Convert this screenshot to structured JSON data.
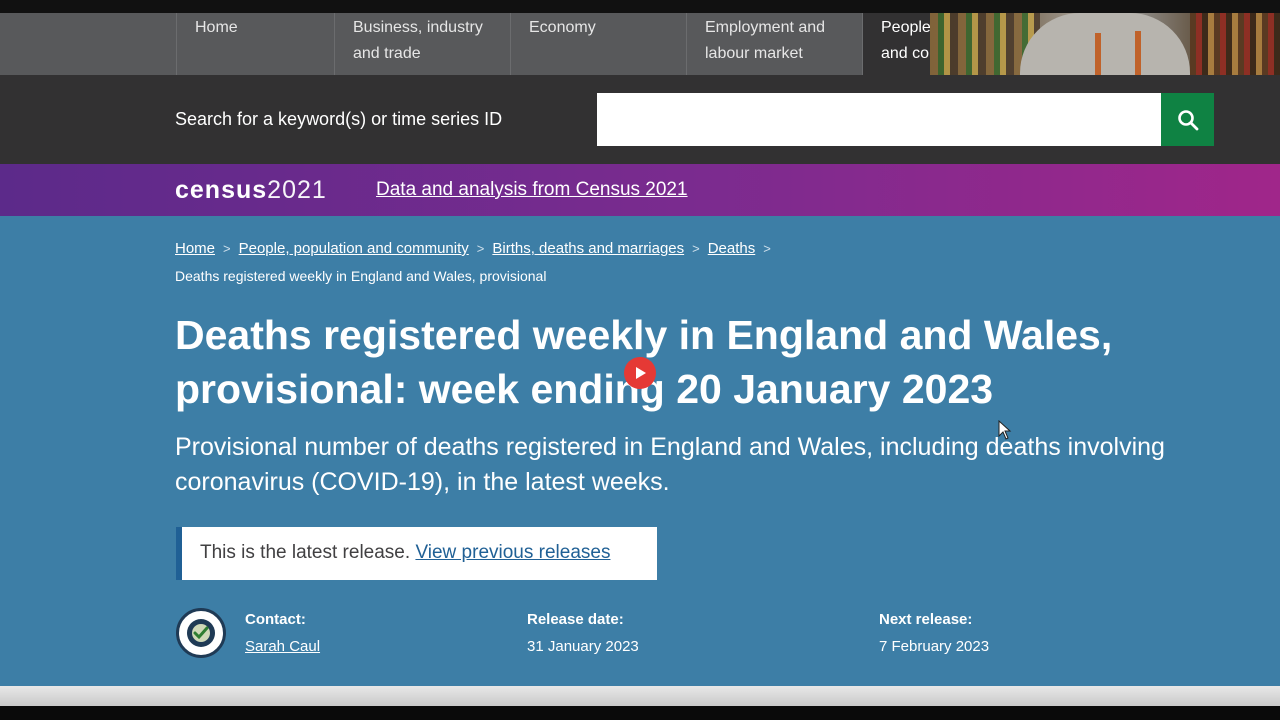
{
  "nav": {
    "items": [
      {
        "label": "Home"
      },
      {
        "label": "Business, industry and trade"
      },
      {
        "label": "Economy"
      },
      {
        "label": "Employment and labour market"
      },
      {
        "label": "People and co"
      }
    ]
  },
  "search": {
    "label": "Search for a keyword(s) or time series ID",
    "value": "",
    "button_icon": "search-icon"
  },
  "census": {
    "logo_word": "census",
    "logo_year": "2021",
    "link_text": "Data and analysis from Census 2021"
  },
  "breadcrumb": {
    "items": [
      {
        "label": "Home"
      },
      {
        "label": "People, population and community"
      },
      {
        "label": "Births, deaths and marriages"
      },
      {
        "label": "Deaths"
      }
    ],
    "current": "Deaths registered weekly in England and Wales, provisional"
  },
  "page": {
    "title": "Deaths registered weekly in England and Wales, provisional: week ending 20 January 2023",
    "subtitle": "Provisional number of deaths registered in England and Wales, including deaths involving coronavirus (COVID-19), in the latest weeks."
  },
  "release_notice": {
    "text": "This is the latest release.",
    "link": "View previous releases"
  },
  "meta": {
    "contact_label": "Contact:",
    "contact_name": "Sarah Caul",
    "release_label": "Release date:",
    "release_value": "31 January 2023",
    "next_label": "Next release:",
    "next_value": "7 February 2023"
  },
  "colors": {
    "hero": "#3d7ea6",
    "nav": "#58595b",
    "search_band": "#323132",
    "search_button": "#0f8243",
    "census_band_start": "#5c2a8a",
    "census_band_end": "#a0268a"
  }
}
